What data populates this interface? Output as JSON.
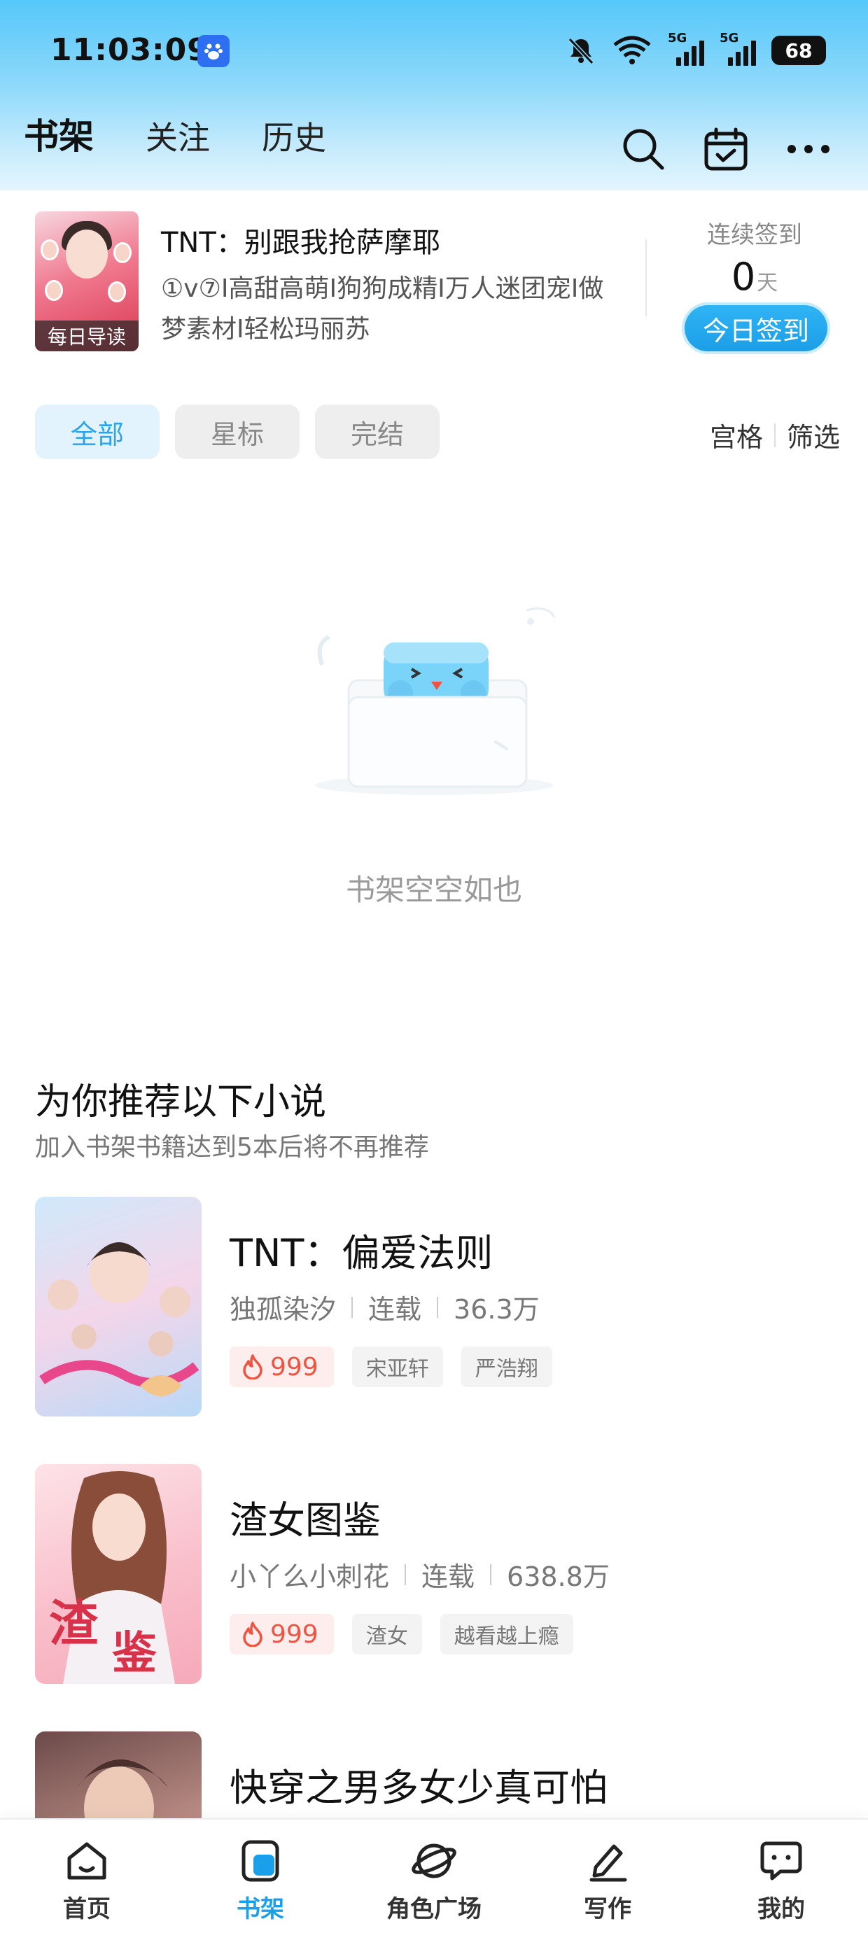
{
  "status_bar": {
    "time": "11:03:09",
    "battery": "68",
    "network_label": "5G"
  },
  "header": {
    "tabs": [
      {
        "label": "书架",
        "active": true
      },
      {
        "label": "关注",
        "active": false
      },
      {
        "label": "历史",
        "active": false
      }
    ],
    "icons": [
      "search-icon",
      "calendar-check-icon",
      "more-icon"
    ]
  },
  "daily": {
    "cover_label": "每日导读",
    "title": "TNT：别跟我抢萨摩耶",
    "description": "①v⑦I高甜高萌I狗狗成精I万人迷团宠I做梦素材I轻松玛丽苏",
    "sign_label": "连续签到",
    "sign_count": "0",
    "sign_unit": "天",
    "sign_button": "今日签到"
  },
  "filters": {
    "chips": [
      {
        "label": "全部",
        "active": true
      },
      {
        "label": "星标",
        "active": false
      },
      {
        "label": "完结",
        "active": false
      }
    ],
    "grid_label": "宫格",
    "filter_label": "筛选"
  },
  "empty_state": {
    "text": "书架空空如也"
  },
  "recommend": {
    "heading": "为你推荐以下小说",
    "subheading": "加入书架书籍达到5本后将不再推荐",
    "books": [
      {
        "title": "TNT：偏爱法则",
        "author": "独孤染汐",
        "status": "连载",
        "count": "36.3万",
        "hot": "999",
        "tags": [
          "宋亚轩",
          "严浩翔"
        ]
      },
      {
        "title": "渣女图鉴",
        "author": "小丫么小刺花",
        "status": "连载",
        "count": "638.8万",
        "hot": "999",
        "tags": [
          "渣女",
          "越看越上瘾"
        ]
      },
      {
        "title": "快穿之男多女少真可怕"
      }
    ]
  },
  "bottom_nav": {
    "items": [
      {
        "label": "首页",
        "icon": "home-icon",
        "active": false
      },
      {
        "label": "书架",
        "icon": "bookshelf-icon",
        "active": true
      },
      {
        "label": "角色广场",
        "icon": "planet-icon",
        "active": false
      },
      {
        "label": "写作",
        "icon": "pen-icon",
        "active": false
      },
      {
        "label": "我的",
        "icon": "chat-bubble-icon",
        "active": false
      }
    ]
  },
  "colors": {
    "accent": "#1aa0ea",
    "hot": "#f05440",
    "header_top": "#55c7f9"
  }
}
